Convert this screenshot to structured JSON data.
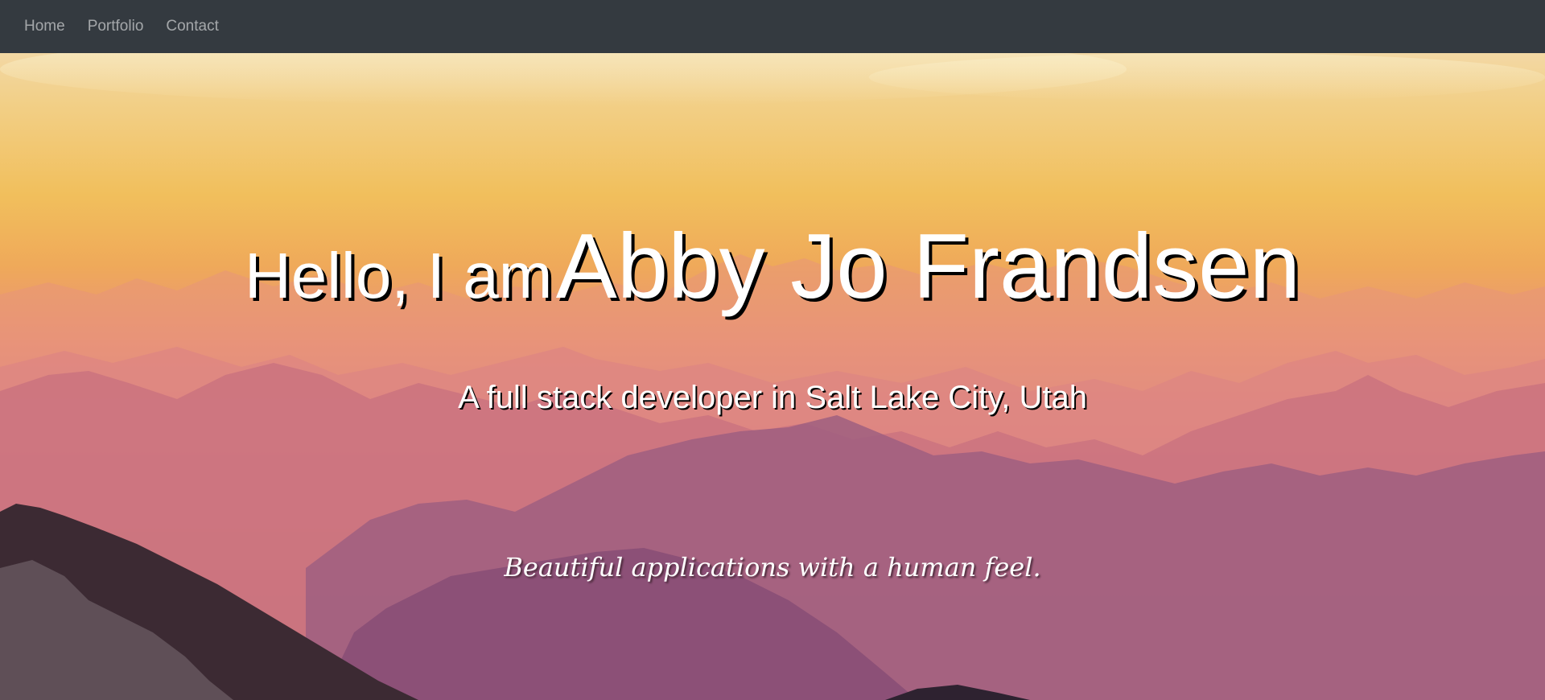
{
  "nav": {
    "items": [
      {
        "label": "Home"
      },
      {
        "label": "Portfolio"
      },
      {
        "label": "Contact"
      }
    ]
  },
  "hero": {
    "greeting_prefix": "Hello, I am",
    "name": "Abby Jo Frandsen",
    "subtitle": "A full stack developer in Salt Lake City, Utah",
    "tagline": "Beautiful applications with a human feel.",
    "background_icon": "mountain-sunset-image"
  },
  "colors": {
    "navbar": "#343a40",
    "nav_link": "#9a9da0",
    "hero_text": "#ffffff"
  }
}
